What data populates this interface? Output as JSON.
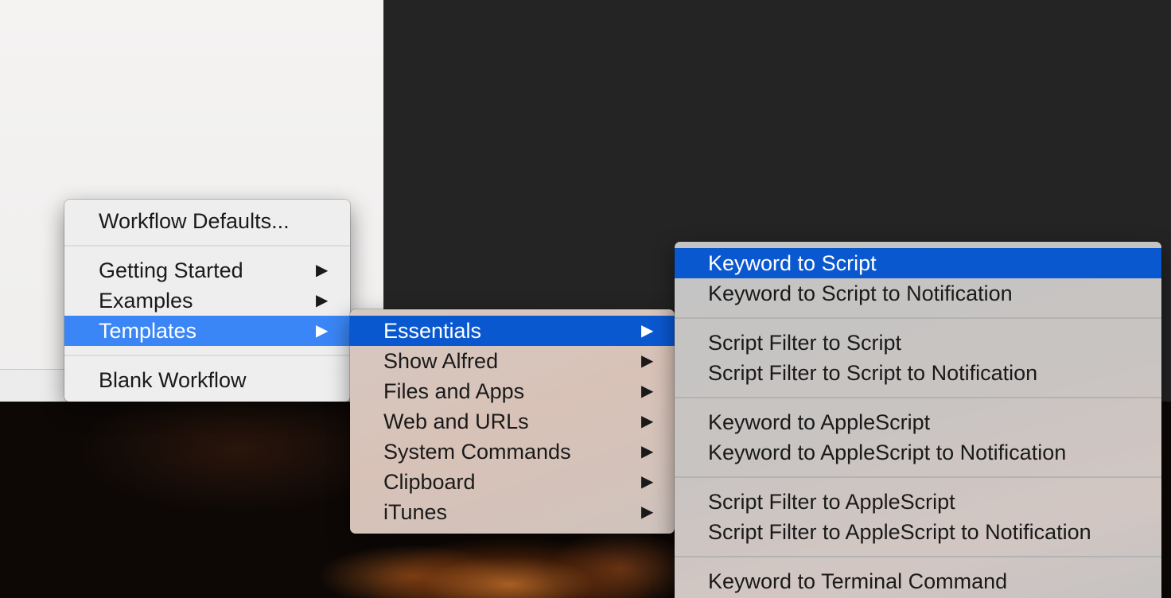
{
  "menu_defaults": {
    "workflow_defaults": "Workflow Defaults...",
    "getting_started": "Getting Started",
    "examples": "Examples",
    "templates": "Templates",
    "blank_workflow": "Blank Workflow"
  },
  "templates_submenu": {
    "items": [
      {
        "label": "Essentials"
      },
      {
        "label": "Show Alfred"
      },
      {
        "label": "Files and Apps"
      },
      {
        "label": "Web and URLs"
      },
      {
        "label": "System Commands"
      },
      {
        "label": "Clipboard"
      },
      {
        "label": "iTunes"
      }
    ]
  },
  "essentials_submenu": {
    "items": [
      "Keyword to Script",
      "Keyword to Script to Notification",
      "Script Filter to Script",
      "Script Filter to Script to Notification",
      "Keyword to AppleScript",
      "Keyword to AppleScript to Notification",
      "Script Filter to AppleScript",
      "Script Filter to AppleScript to Notification",
      "Keyword to Terminal Command"
    ]
  },
  "glyphs": {
    "submenu_arrow": "▶"
  },
  "colors": {
    "selection_active": "#0a58d0",
    "selection_parent": "#3a86f6"
  }
}
